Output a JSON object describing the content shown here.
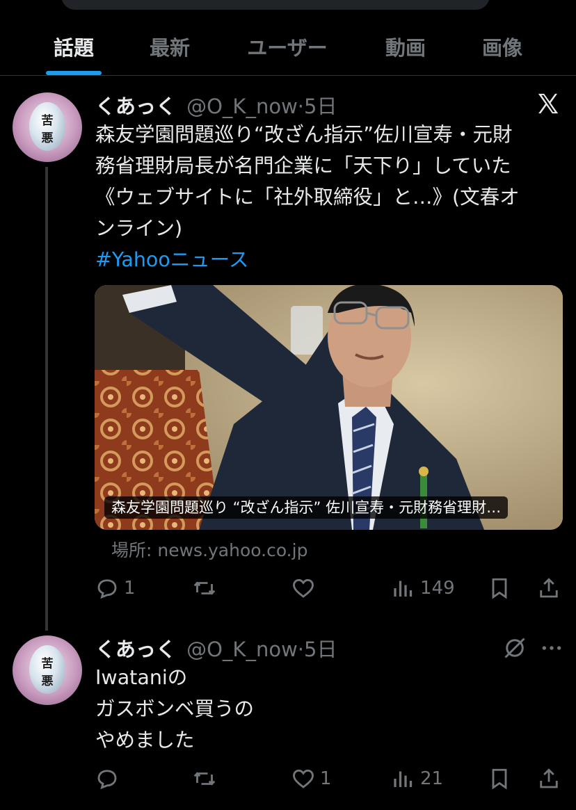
{
  "tabs": [
    {
      "label": "話題",
      "active": true
    },
    {
      "label": "最新",
      "active": false
    },
    {
      "label": "ユーザー",
      "active": false
    },
    {
      "label": "動画",
      "active": false
    },
    {
      "label": "画像",
      "active": false
    }
  ],
  "tweets": [
    {
      "name": "くあっく",
      "handle": "@O_K_now",
      "time": "·5日",
      "avatar_text": [
        "苦",
        "悪"
      ],
      "text_lines": [
        "森友学園問題巡り“改ざん指示”佐川宣寿・元財",
        "務省理財局長が名門企業に「天下り」していた",
        "《ウェブサイトに「社外取締役」と…》(文春オ",
        "ンライン)"
      ],
      "hashtag": "#Yahooニュース",
      "card": {
        "caption": "森友学園問題巡り “改ざん指示” 佐川宣寿・元財務省理財…",
        "source": "場所: news.yahoo.co.jp"
      },
      "stats": {
        "replies": "1",
        "retweets": "",
        "likes": "",
        "views": "149"
      },
      "source_icon": "x-logo-icon"
    },
    {
      "name": "くあっく",
      "handle": "@O_K_now",
      "time": "·5日",
      "avatar_text": [
        "苦",
        "悪"
      ],
      "text_lines": [
        "Iwataniの",
        "ガスボンベ買うの",
        "やめました"
      ],
      "stats": {
        "replies": "",
        "retweets": "",
        "likes": "1",
        "views": "21"
      },
      "source_icon": "muted-icon"
    }
  ],
  "colors": {
    "background": "#000000",
    "text": "#e7e9ea",
    "muted": "#71767b",
    "accent": "#1d9bf0",
    "divider": "#2f3336"
  }
}
